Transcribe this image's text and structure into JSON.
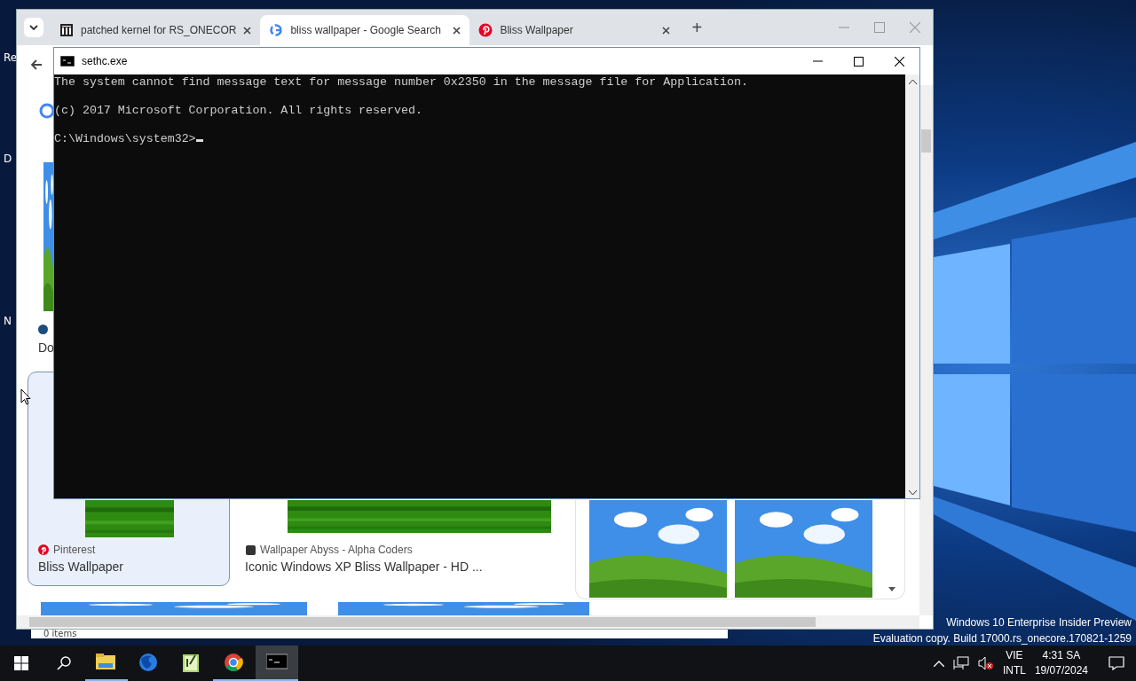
{
  "desktop": {
    "icon_labels": [
      "Re",
      "D",
      "N"
    ],
    "watermark": [
      "Windows 10 Enterprise Insider Preview",
      "Evaluation copy. Build 17000.rs_onecore.170821-1259"
    ]
  },
  "explorer": {
    "status": "0 items"
  },
  "browser": {
    "tabs": [
      {
        "title": "patched kernel for RS_ONECOR",
        "kind": "archive",
        "selected": false
      },
      {
        "title": "bliss wallpaper - Google Search",
        "kind": "search",
        "selected": true
      },
      {
        "title": "Bliss Wallpaper",
        "kind": "pin",
        "selected": false
      }
    ],
    "new_tab": "+",
    "results": [
      {
        "title": "Do",
        "selected": false
      },
      {
        "source": "Pinterest",
        "kind": "pin",
        "title": "Bliss Wallpaper",
        "selected": true
      },
      {
        "source": "Wallpaper Abyss - Alpha Coders",
        "kind": "square",
        "title": "Iconic Windows XP Bliss Wallpaper - HD ...",
        "selected": false
      }
    ]
  },
  "console": {
    "title": "sethc.exe",
    "lines": [
      "The system cannot find message text for message number 0x2350 in the message file for Application.",
      "(c) 2017 Microsoft Corporation. All rights reserved."
    ],
    "prompt": "C:\\Windows\\system32>"
  },
  "taskbar": {
    "apps": [
      {
        "kind": "folder",
        "running": true,
        "active": false
      },
      {
        "kind": "fox",
        "running": false,
        "active": false
      },
      {
        "kind": "notepad",
        "running": false,
        "active": false
      },
      {
        "kind": "ring",
        "running": true,
        "active": false
      },
      {
        "kind": "terminal",
        "running": true,
        "active": true
      }
    ],
    "language": [
      "VIE",
      "INTL"
    ],
    "time": "4:31 SA",
    "date": "19/07/2024"
  }
}
